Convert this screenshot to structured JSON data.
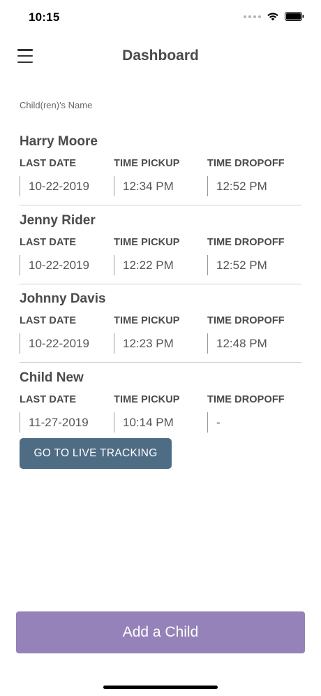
{
  "status_bar": {
    "time": "10:15"
  },
  "header": {
    "title": "Dashboard"
  },
  "main": {
    "section_label": "Child(ren)'s Name",
    "column_labels": [
      "LAST DATE",
      "TIME PICKUP",
      "TIME DROPOFF"
    ],
    "children": [
      {
        "name": "Harry Moore",
        "last_date": "10-22-2019",
        "time_pickup": "12:34 PM",
        "time_dropoff": "12:52 PM"
      },
      {
        "name": "Jenny Rider",
        "last_date": "10-22-2019",
        "time_pickup": "12:22 PM",
        "time_dropoff": "12:52 PM"
      },
      {
        "name": "Johnny Davis",
        "last_date": "10-22-2019",
        "time_pickup": "12:23 PM",
        "time_dropoff": "12:48 PM"
      },
      {
        "name": "Child New",
        "last_date": "11-27-2019",
        "time_pickup": "10:14 PM",
        "time_dropoff": "-"
      }
    ],
    "live_tracking_label": "GO TO LIVE TRACKING"
  },
  "footer": {
    "add_child_label": "Add a Child"
  },
  "colors": {
    "live_button": "#4f6c85",
    "add_button": "#9482b9",
    "title_text": "#4a4a4a"
  },
  "icons": [
    "wifi-icon",
    "battery-icon",
    "hamburger-menu-icon",
    "signal-dots-icon"
  ]
}
